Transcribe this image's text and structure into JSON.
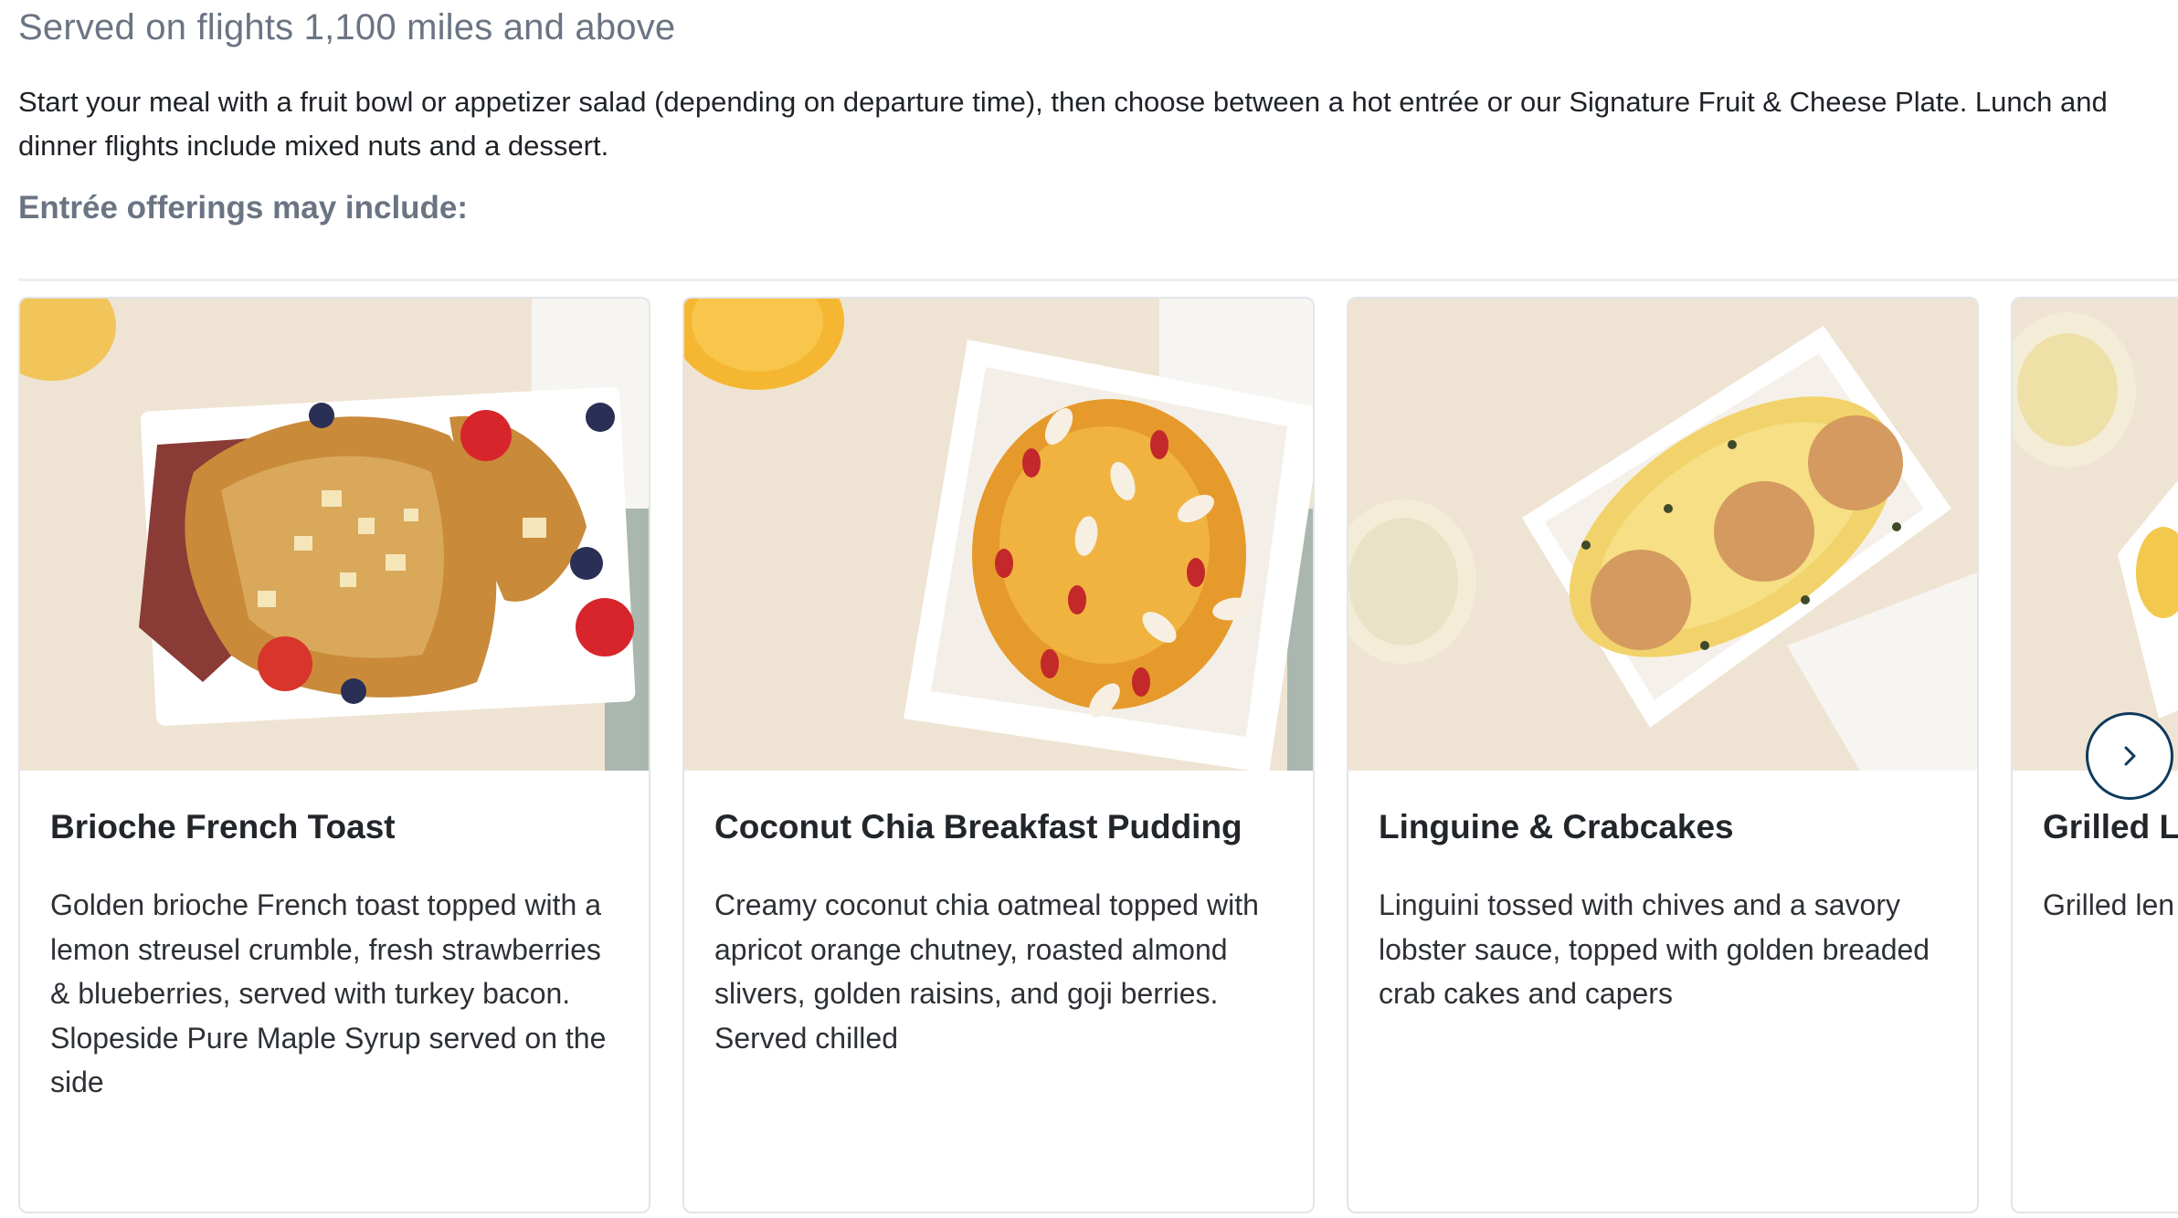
{
  "header": {
    "subtitle": "Served on flights 1,100 miles and above",
    "intro": "Start your meal with a fruit bowl or appetizer salad (depending on departure time), then choose between a hot entrée or our Signature Fruit & Cheese Plate. Lunch and dinner flights include mixed nuts and a dessert.",
    "offerings_label": "Entrée offerings may include:"
  },
  "cards": [
    {
      "title": "Brioche French Toast",
      "description": "Golden brioche French toast topped with a lemon streusel crumble, fresh strawberries & blueberries, served with turkey bacon. Slopeside Pure Maple Syrup served on the side"
    },
    {
      "title": "Coconut Chia Breakfast Pudding",
      "description": "Creamy coconut chia oatmeal topped with apricot orange chutney, roasted almond slivers, golden raisins, and goji berries. Served chilled"
    },
    {
      "title": "Linguine & Crabcakes",
      "description": "Linguini tossed with chives and a savory lobster sauce, topped with golden breaded crab cakes and capers"
    },
    {
      "title": "Grilled L",
      "description": "Grilled len served wi scented h lemongras"
    }
  ],
  "icons": {
    "next": "chevron-right-icon"
  },
  "colors": {
    "accent": "#0e3a5c",
    "muted_text": "#6a7483",
    "card_border": "#e3e5e8"
  }
}
